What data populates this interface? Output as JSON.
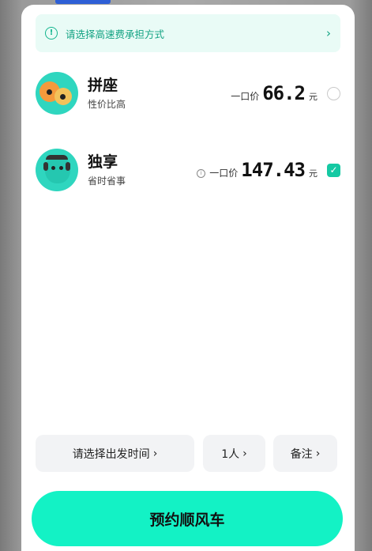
{
  "notice": {
    "text": "请选择高速费承担方式",
    "chevron": "›"
  },
  "options": [
    {
      "title": "拼座",
      "subtitle": "性价比高",
      "price_label": "一口价",
      "price": "66.2",
      "unit": "元",
      "selected": false
    },
    {
      "title": "独享",
      "subtitle": "省时省事",
      "price_label": "一口价",
      "price": "147.43",
      "unit": "元",
      "selected": true
    }
  ],
  "actions": {
    "time": "请选择出发时间",
    "people": "1人",
    "note": "备注"
  },
  "cta": {
    "label": "预约顺风车"
  },
  "colors": {
    "accent": "#13f2c5",
    "notice_bg": "#e9fbf6",
    "notice_text": "#13a383",
    "checked": "#15c9a3"
  }
}
